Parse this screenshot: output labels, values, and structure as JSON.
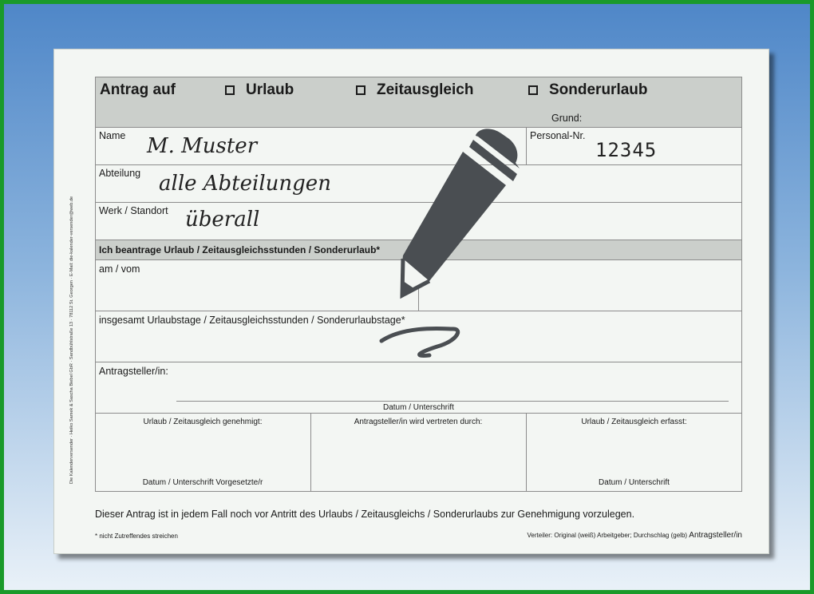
{
  "form": {
    "title": "Antrag auf",
    "option_urlaub": "Urlaub",
    "option_zeitausgleich": "Zeitausgleich",
    "option_sonderurlaub": "Sonderurlaub",
    "grund_label": "Grund:",
    "name_label": "Name",
    "name_value": "M. Muster",
    "personal_label": "Personal-Nr.",
    "personal_value": "12345",
    "abteilung_label": "Abteilung",
    "abteilung_value": "alle Abteilungen",
    "werk_label": "Werk / Standort",
    "werk_value": "überall",
    "section_heading": "Ich beantrage Urlaub / Zeitausgleichsstunden / Sonderurlaub*",
    "am_vom_label": "am / vom",
    "insgesamt_label": "insgesamt Urlaubstage / Zeitausgleichsstunden / Sonderurlaubstage*",
    "antragsteller_label": "Antragsteller/in:",
    "datum_unterschrift": "Datum / Unterschrift",
    "col1_label": "Urlaub / Zeitausgleich genehmigt:",
    "col1_footer": "Datum / Unterschrift Vorgesetzte/r",
    "col2_label": "Antragsteller/in wird vertreten durch:",
    "col3_label": "Urlaub / Zeitausgleich erfasst:",
    "col3_footer": "Datum / Unterschrift",
    "notice": "Dieser Antrag ist in jedem Fall noch vor Antritt des Urlaubs / Zeitausgleichs / Sonderurlaubs zur Genehmigung vorzulegen.",
    "footnote": "* nicht Zutreffendes streichen",
    "distribution": "Verteiler: Original (weiß) Arbeitgeber; Durchschlag (gelb)",
    "distribution_bold": "Antragsteller/in",
    "side_text": "Die Kalenderversender · Heiko Samek & Sascha Biebel GbR · Sandbühlstraße 13 · 78112 St. Georgen · E-Mail: die-kalender-versender@web.de"
  },
  "colors": {
    "frame": "#1a9a2a",
    "header_grey": "#cbcfcb",
    "pencil": "#4a4e52"
  },
  "icons": [
    "pencil-icon",
    "checkbox-icon"
  ]
}
